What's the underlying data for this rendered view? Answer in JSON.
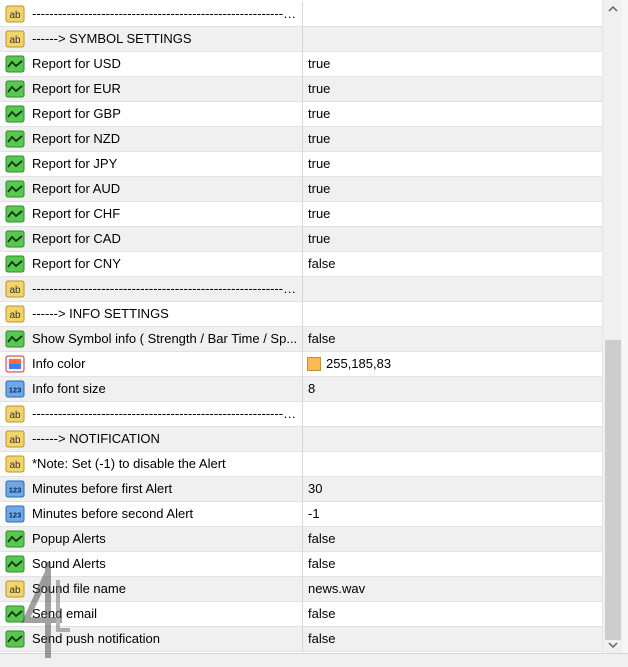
{
  "rows": [
    {
      "icon": "string-ab-icon",
      "name": "-------------------------------------------------------------------",
      "value": ""
    },
    {
      "icon": "string-ab-icon",
      "name": "------> SYMBOL SETTINGS",
      "value": ""
    },
    {
      "icon": "bool-check-icon",
      "name": "Report for USD",
      "value": "true"
    },
    {
      "icon": "bool-check-icon",
      "name": "Report for EUR",
      "value": "true"
    },
    {
      "icon": "bool-check-icon",
      "name": "Report for GBP",
      "value": "true"
    },
    {
      "icon": "bool-check-icon",
      "name": "Report for NZD",
      "value": "true"
    },
    {
      "icon": "bool-check-icon",
      "name": "Report for JPY",
      "value": "true"
    },
    {
      "icon": "bool-check-icon",
      "name": "Report for AUD",
      "value": "true"
    },
    {
      "icon": "bool-check-icon",
      "name": "Report for CHF",
      "value": "true"
    },
    {
      "icon": "bool-check-icon",
      "name": "Report for CAD",
      "value": "true"
    },
    {
      "icon": "bool-check-icon",
      "name": "Report for CNY",
      "value": "false"
    },
    {
      "icon": "string-ab-icon",
      "name": "-------------------------------------------------------------------",
      "value": ""
    },
    {
      "icon": "string-ab-icon",
      "name": "------> INFO SETTINGS",
      "value": ""
    },
    {
      "icon": "bool-check-icon",
      "name": "Show Symbol info ( Strength / Bar Time / Sp...",
      "value": "false"
    },
    {
      "icon": "color-icon",
      "name": "Info color",
      "value": "255,185,83",
      "swatch": "#ffb953"
    },
    {
      "icon": "int-123-icon",
      "name": "Info font size",
      "value": "8"
    },
    {
      "icon": "string-ab-icon",
      "name": "-------------------------------------------------------------------",
      "value": ""
    },
    {
      "icon": "string-ab-icon",
      "name": "------> NOTIFICATION",
      "value": ""
    },
    {
      "icon": "string-ab-icon",
      "name": "*Note: Set (-1) to disable the Alert",
      "value": ""
    },
    {
      "icon": "int-123-icon",
      "name": "Minutes before first Alert",
      "value": "30"
    },
    {
      "icon": "int-123-icon",
      "name": "Minutes before second Alert",
      "value": "-1"
    },
    {
      "icon": "bool-check-icon",
      "name": "Popup Alerts",
      "value": "false"
    },
    {
      "icon": "bool-check-icon",
      "name": "Sound Alerts",
      "value": "false"
    },
    {
      "icon": "string-ab-icon",
      "name": "Sound file name",
      "value": "news.wav"
    },
    {
      "icon": "bool-check-icon",
      "name": "Send email",
      "value": "false"
    },
    {
      "icon": "bool-check-icon",
      "name": "Send push notification",
      "value": "false"
    }
  ],
  "colors": {
    "alt_row": "#f0f0f0",
    "ab_icon_fill": "#f5d36b",
    "check_icon_fill": "#58c850",
    "int_icon_fill": "#6fa8e6",
    "color_swatch": "#ffb953"
  }
}
